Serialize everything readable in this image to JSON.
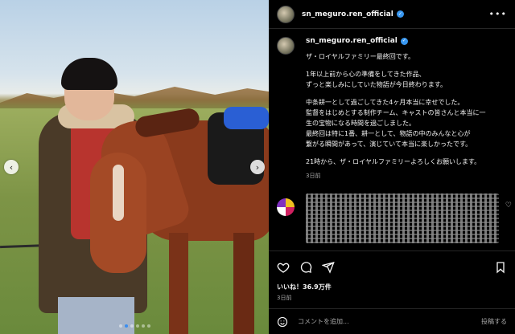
{
  "post": {
    "username": "sn_meguro.ren_official",
    "caption_lines": [
      "ザ・ロイヤルファミリー最終回です。",
      "1年以上前から心の準備をしてきた作品、\nずっと楽しみにしていた物語が今日終わります。",
      "中条耕一として過ごしてきた4ヶ月本当に幸せでした。\n監督をはじめとする制作チーム、キャストの皆さんと本当に一\n生の宝物になる時間を過ごしました。\n最終回は特に1番、耕一として、物語の中のみんなと心が\n繋がる瞬間があって、演じていて本当に楽しかったです。",
      "21時から、ザ・ロイヤルファミリーよろしくお願いします。"
    ],
    "caption_time": "3日前",
    "likes": "いいね！36.9万件",
    "post_time": "3日前"
  },
  "comment_box": {
    "placeholder": "コメントを追加...",
    "post_label": "投稿する"
  },
  "icons": {
    "verified": "verified-badge-icon",
    "more": "more-options-icon",
    "like": "heart-icon",
    "comment": "comment-icon",
    "share": "share-icon",
    "save": "bookmark-icon",
    "emoji": "emoji-icon",
    "prev": "chevron-left-icon",
    "next": "chevron-right-icon"
  },
  "colors": {
    "background": "#000000",
    "text": "#f5f5f5",
    "muted": "#a8a8a8",
    "verified": "#3897f0",
    "carousel_active_dot": "#3b8ef0"
  },
  "carousel": {
    "count": 6,
    "active": 1
  }
}
